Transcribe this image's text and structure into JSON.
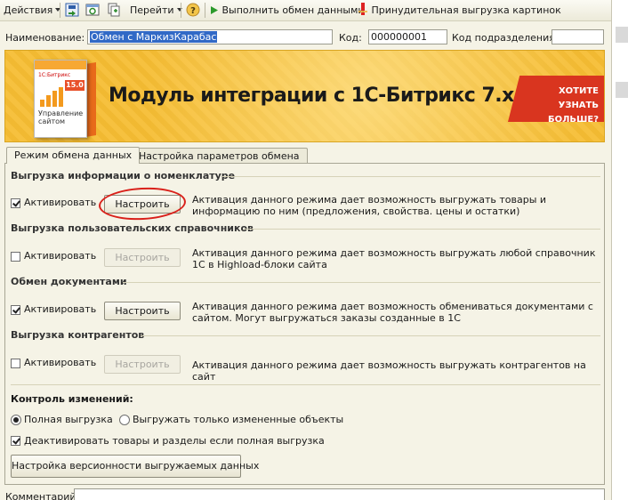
{
  "toolbar": {
    "actions_label": "Действия",
    "goto_label": "Перейти",
    "run_exchange_label": "Выполнить обмен данными",
    "force_upload_label": "Принудительная выгрузка картинок"
  },
  "form": {
    "name_label": "Наименование:",
    "name_value": "Обмен с МаркизКарабас",
    "code_label": "Код:",
    "code_value": "000000001",
    "subdivision_code_label": "Код подразделения:",
    "subdivision_code_value": ""
  },
  "banner": {
    "box_brand": "1С:Битрикс",
    "box_version": "15.0",
    "box_title": "Управление сайтом",
    "title": "Модуль интеграции с 1С-Битрикс 7.x",
    "cta_line1": "ХОТИТЕ",
    "cta_line2": "УЗНАТЬ БОЛЬШЕ?"
  },
  "tabs": [
    {
      "label": "Режим обмена данных",
      "active": true
    },
    {
      "label": "Настройка параметров обмена",
      "active": false
    }
  ],
  "sections": [
    {
      "heading": "Выгрузка информации о номенклатуре",
      "activate_label": "Активировать",
      "checked": true,
      "configure_label": "Настроить",
      "configure_enabled": true,
      "description": "Активация данного режима дает возможность выгружать товары и информацию по ним (предложения, свойства. цены и остатки)"
    },
    {
      "heading": "Выгрузка пользовательских справочников",
      "activate_label": "Активировать",
      "checked": false,
      "configure_label": "Настроить",
      "configure_enabled": false,
      "description": "Активация данного режима дает возможность выгружать любой справочник 1С в Highload-блоки сайта"
    },
    {
      "heading": "Обмен документами",
      "activate_label": "Активировать",
      "checked": true,
      "configure_label": "Настроить",
      "configure_enabled": true,
      "description": "Активация данного режима дает возможность обмениваться документами с сайтом. Могут выгружаться заказы созданные в 1С"
    },
    {
      "heading": "Выгрузка контрагентов",
      "activate_label": "Активировать",
      "checked": false,
      "configure_label": "Настроить",
      "configure_enabled": false,
      "description": "Активация данного режима дает возможность выгружать контрагентов на сайт"
    }
  ],
  "change_control": {
    "heading": "Контроль изменений:",
    "option_full": "Полная выгрузка",
    "option_changed": "Выгружать только измененные объекты",
    "selected": "full",
    "deactivate_label": "Деактивировать товары и разделы если полная выгрузка",
    "deactivate_checked": true,
    "versioning_button": "Настройка версионности выгружаемых данных"
  },
  "comment_label": "Комментарий:",
  "colors": {
    "window_bg": "#f5f3e6",
    "banner_bg": "#f6bd33",
    "cta_bg": "#d9351f",
    "annotation": "#d9201a",
    "selection": "#3169c6"
  }
}
